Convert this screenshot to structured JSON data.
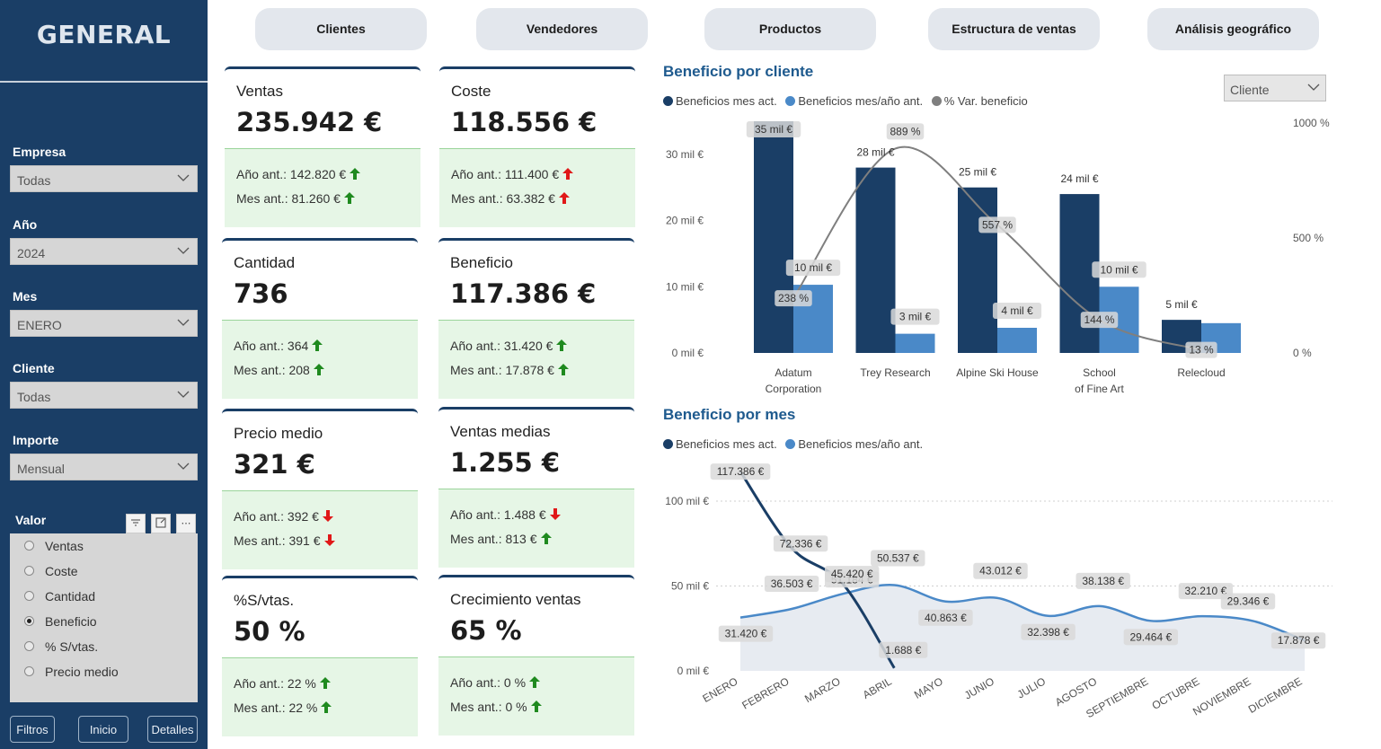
{
  "sidebar": {
    "title": "GENERAL",
    "filters": [
      {
        "label": "Empresa",
        "value": "Todas"
      },
      {
        "label": "Año",
        "value": "2024"
      },
      {
        "label": "Mes",
        "value": "ENERO"
      },
      {
        "label": "Cliente",
        "value": "Todas"
      },
      {
        "label": "Importe",
        "value": "Mensual"
      }
    ],
    "valor": {
      "label": "Valor",
      "options": [
        {
          "label": "Ventas",
          "selected": false
        },
        {
          "label": "Coste",
          "selected": false
        },
        {
          "label": "Cantidad",
          "selected": false
        },
        {
          "label": "Beneficio",
          "selected": true
        },
        {
          "label": "% S/vtas.",
          "selected": false
        },
        {
          "label": "Precio medio",
          "selected": false
        }
      ]
    },
    "buttons": {
      "filtros": "Filtros",
      "inicio": "Inicio",
      "detalles": "Detalles"
    }
  },
  "nav": {
    "tabs": [
      "Clientes",
      "Vendedores",
      "Productos",
      "Estructura de ventas",
      "Análisis geográfico"
    ]
  },
  "kpis": [
    {
      "title": "Ventas",
      "value": "235.942 €",
      "prev_year": "Año ant.: 142.820 €",
      "prev_year_trend": "up-green",
      "prev_month": "Mes ant.: 81.260 €",
      "prev_month_trend": "up-green"
    },
    {
      "title": "Coste",
      "value": "118.556 €",
      "prev_year": "Año ant.: 111.400 €",
      "prev_year_trend": "up-red",
      "prev_month": "Mes ant.: 63.382 €",
      "prev_month_trend": "up-red"
    },
    {
      "title": "Cantidad",
      "value": "736",
      "prev_year": "Año ant.: 364",
      "prev_year_trend": "up-green",
      "prev_month": "Mes ant.: 208",
      "prev_month_trend": "up-green"
    },
    {
      "title": "Beneficio",
      "value": "117.386 €",
      "prev_year": "Año ant.: 31.420 €",
      "prev_year_trend": "up-green",
      "prev_month": "Mes ant.: 17.878 €",
      "prev_month_trend": "up-green"
    },
    {
      "title": "Precio medio",
      "value": "321 €",
      "prev_year": "Año ant.: 392 €",
      "prev_year_trend": "down-red",
      "prev_month": "Mes ant.: 391 €",
      "prev_month_trend": "down-red"
    },
    {
      "title": "Ventas medias",
      "value": "1.255 €",
      "prev_year": "Año ant.: 1.488 €",
      "prev_year_trend": "down-red",
      "prev_month": "Mes ant.: 813 €",
      "prev_month_trend": "up-green"
    },
    {
      "title": "%S/vtas.",
      "value": "50 %",
      "prev_year": "Año ant.: 22 %",
      "prev_year_trend": "up-green",
      "prev_month": "Mes ant.: 22 %",
      "prev_month_trend": "up-green"
    },
    {
      "title": "Crecimiento ventas",
      "value": "65 %",
      "prev_year": "Año ant.: 0 %",
      "prev_year_trend": "up-green",
      "prev_month": "Mes ant.: 0 %",
      "prev_month_trend": "up-green"
    }
  ],
  "colors": {
    "dark_blue": "#1a3e66",
    "mid_blue": "#4a89c8",
    "gray_line": "#7f7f7f",
    "up_green": "#1f8a1f",
    "red": "#e01818"
  },
  "client_chart": {
    "dropdown_value": "Cliente",
    "legend": [
      "Beneficios mes act.",
      "Beneficios mes/año ant.",
      "% Var. beneficio"
    ]
  },
  "month_chart": {
    "legend": [
      "Beneficios mes act.",
      "Beneficios mes/año ant."
    ]
  },
  "chart_data": [
    {
      "type": "bar",
      "title": "Beneficio por cliente",
      "categories": [
        "Adatum Corporation",
        "Trey Research",
        "Alpine Ski House",
        "School of Fine Art",
        "Relecloud"
      ],
      "series": [
        {
          "name": "Beneficios mes act.",
          "values": [
            35000,
            28000,
            25000,
            24000,
            5000
          ],
          "labels": [
            "35 mil €",
            "28 mil €",
            "25 mil €",
            "24 mil €",
            "5 mil €"
          ]
        },
        {
          "name": "Beneficios mes/año ant.",
          "values": [
            10300,
            2900,
            3800,
            10000,
            4500
          ],
          "labels": [
            "10 mil €",
            "3 mil €",
            "4 mil €",
            "10 mil €",
            ""
          ]
        },
        {
          "name": "% Var. beneficio",
          "axis": "right",
          "values": [
            238,
            889,
            557,
            144,
            13
          ],
          "labels": [
            "238 %",
            "889 %",
            "557 %",
            "144 %",
            "13 %"
          ]
        }
      ],
      "y_ticks": [
        "0 mil €",
        "10 mil €",
        "20 mil €",
        "30 mil €"
      ],
      "y2_ticks": [
        "0 %",
        "500 %",
        "1000 %"
      ],
      "ylim": [
        0,
        35000
      ],
      "y2lim": [
        0,
        1000
      ]
    },
    {
      "type": "area",
      "title": "Beneficio por mes",
      "categories": [
        "ENERO",
        "FEBRERO",
        "MARZO",
        "ABRIL",
        "MAYO",
        "JUNIO",
        "JULIO",
        "AGOSTO",
        "SEPTIEMBRE",
        "OCTUBRE",
        "NOVIEMBRE",
        "DICIEMBRE"
      ],
      "series": [
        {
          "name": "Beneficios mes act.",
          "values": [
            117386,
            72336,
            51184,
            1688
          ],
          "labels": [
            "117.386 €",
            "72.336 €",
            "51.184 €",
            "1.688 €"
          ]
        },
        {
          "name": "Beneficios mes/año ant.",
          "values": [
            31420,
            36503,
            45420,
            50537,
            40863,
            43012,
            32398,
            38138,
            29464,
            32210,
            29346,
            17878
          ],
          "labels": [
            "31.420 €",
            "36.503 €",
            "45.420 €",
            "50.537 €",
            "40.863 €",
            "43.012 €",
            "32.398 €",
            "38.138 €",
            "29.464 €",
            "32.210 €",
            "29.346 €",
            "17.878 €"
          ]
        }
      ],
      "y_ticks": [
        "0 mil €",
        "50 mil €",
        "100 mil €"
      ],
      "ylim": [
        0,
        100000
      ]
    }
  ]
}
